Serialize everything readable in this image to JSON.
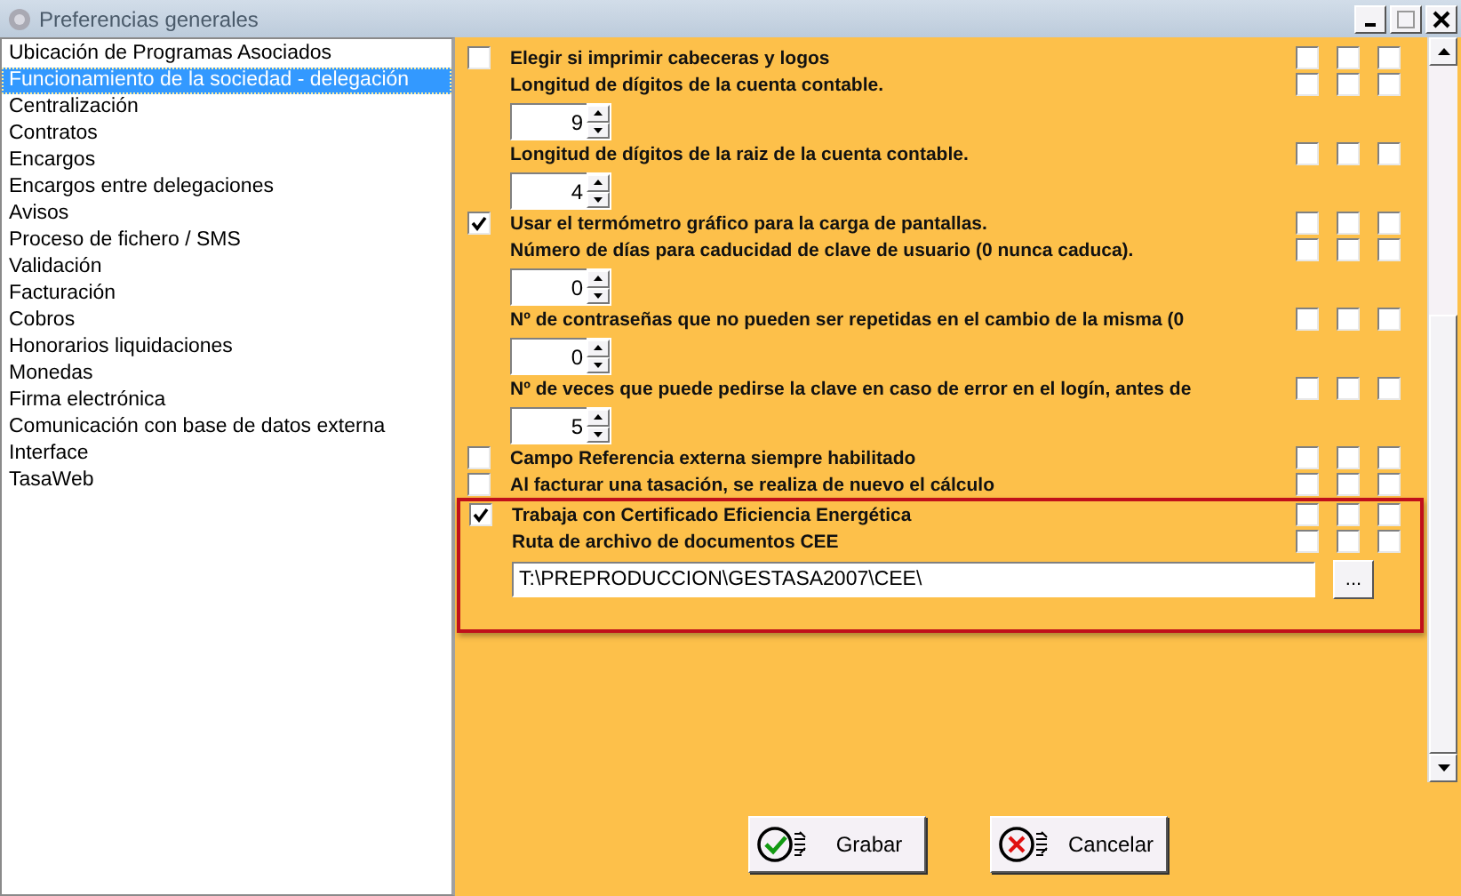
{
  "window": {
    "title": "Preferencias generales"
  },
  "sidebar": {
    "items": [
      {
        "label": "Ubicación de Programas Asociados",
        "selected": false
      },
      {
        "label": "Funcionamiento de la sociedad - delegación",
        "selected": true
      },
      {
        "label": "Centralización",
        "selected": false
      },
      {
        "label": "Contratos",
        "selected": false
      },
      {
        "label": "Encargos",
        "selected": false
      },
      {
        "label": "Encargos entre delegaciones",
        "selected": false
      },
      {
        "label": "Avisos",
        "selected": false
      },
      {
        "label": "Proceso de fichero / SMS",
        "selected": false
      },
      {
        "label": "Validación",
        "selected": false
      },
      {
        "label": "Facturación",
        "selected": false
      },
      {
        "label": "Cobros",
        "selected": false
      },
      {
        "label": "Honorarios liquidaciones",
        "selected": false
      },
      {
        "label": "Monedas",
        "selected": false
      },
      {
        "label": "Firma electrónica",
        "selected": false
      },
      {
        "label": "Comunicación con base de datos externa",
        "selected": false
      },
      {
        "label": "Interface",
        "selected": false
      },
      {
        "label": "TasaWeb",
        "selected": false
      }
    ]
  },
  "settings": {
    "rows": [
      {
        "kind": "checkbox",
        "label": "Elegir si imprimir cabeceras y logos",
        "checked": false,
        "flags": [
          {
            "checked": false
          },
          {
            "checked": false
          },
          {
            "checked": false
          }
        ]
      },
      {
        "kind": "label",
        "label": "Longitud de dígitos de la cuenta contable.",
        "flags": [
          {
            "checked": false
          },
          {
            "checked": false
          },
          {
            "checked": false
          }
        ]
      },
      {
        "kind": "spinner",
        "value": "9"
      },
      {
        "kind": "label",
        "label": "Longitud de dígitos de la raiz de la cuenta contable.",
        "flags": [
          {
            "checked": false
          },
          {
            "checked": false
          },
          {
            "checked": false
          }
        ]
      },
      {
        "kind": "spinner",
        "value": "4"
      },
      {
        "kind": "checkbox",
        "label": "Usar el termómetro gráfico para la carga de pantallas.",
        "checked": true,
        "flags": [
          {
            "checked": false
          },
          {
            "checked": false
          },
          {
            "checked": false
          }
        ]
      },
      {
        "kind": "label",
        "label": "Número de días para caducidad de clave de usuario (0 nunca caduca).",
        "flags": [
          {
            "checked": false
          },
          {
            "checked": false
          },
          {
            "checked": false
          }
        ]
      },
      {
        "kind": "spinner",
        "value": "0"
      },
      {
        "kind": "label",
        "label": "Nº de contraseñas que no pueden ser repetidas en el cambio de la misma (0",
        "flags": [
          {
            "checked": false
          },
          {
            "checked": false
          },
          {
            "checked": false
          }
        ]
      },
      {
        "kind": "spinner",
        "value": "0"
      },
      {
        "kind": "label",
        "label": "Nº de veces que puede pedirse la clave en caso de error en el logín, antes de",
        "flags": [
          {
            "checked": false
          },
          {
            "checked": false
          },
          {
            "checked": false
          }
        ]
      },
      {
        "kind": "spinner",
        "value": "5"
      },
      {
        "kind": "checkbox",
        "label": "Campo Referencia externa siempre habilitado",
        "checked": false,
        "flags": [
          {
            "checked": false
          },
          {
            "checked": false
          },
          {
            "checked": false
          }
        ]
      },
      {
        "kind": "checkbox",
        "label": "Al facturar una tasación, se realiza de nuevo el cálculo",
        "checked": false,
        "flags": [
          {
            "checked": false
          },
          {
            "checked": false
          },
          {
            "checked": false
          }
        ]
      }
    ],
    "highlight_frame": {
      "rows": [
        {
          "kind": "checkbox",
          "label": "Trabaja con Certificado Eficiencia Energética",
          "checked": true,
          "flags": [
            {
              "checked": false
            },
            {
              "checked": false
            },
            {
              "checked": false
            }
          ]
        },
        {
          "kind": "label",
          "label": "Ruta de archivo de documentos CEE",
          "flags": [
            {
              "checked": false
            },
            {
              "checked": false
            },
            {
              "checked": false
            }
          ]
        },
        {
          "kind": "path",
          "value": "T:\\PREPRODUCCION\\GESTASA2007\\CEE\\",
          "button": "..."
        }
      ]
    }
  },
  "buttons": [
    {
      "label": "Grabar",
      "kind": "accept"
    },
    {
      "label": "Cancelar",
      "kind": "cancel"
    }
  ]
}
